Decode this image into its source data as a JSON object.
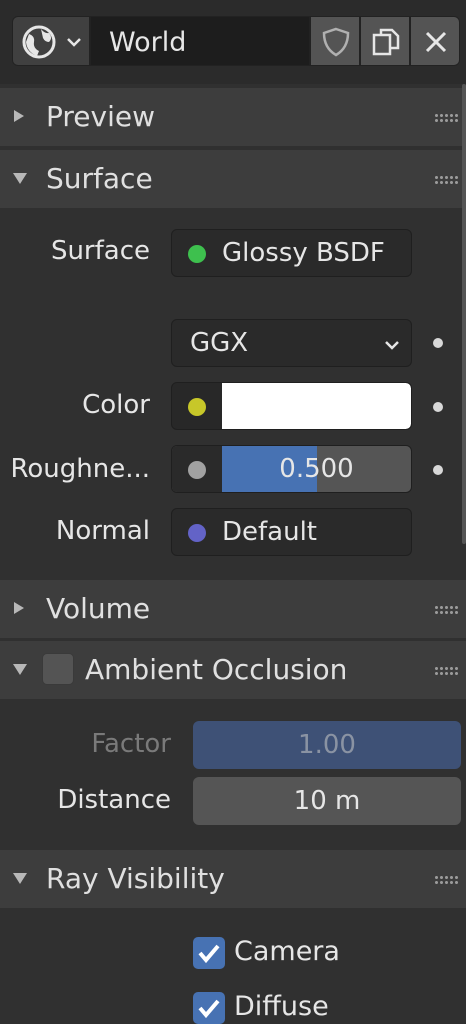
{
  "header": {
    "name": "World",
    "type_icon": "world-icon",
    "fake_user_icon": "shield-icon",
    "duplicate_icon": "duplicate-icon",
    "unlink_icon": "close-icon"
  },
  "panels": {
    "preview": {
      "title": "Preview",
      "expanded": false
    },
    "surface": {
      "title": "Surface",
      "expanded": true
    },
    "volume": {
      "title": "Volume",
      "expanded": false
    },
    "ao": {
      "title": "Ambient Occlusion",
      "expanded": true,
      "enabled": false
    },
    "ray": {
      "title": "Ray Visibility",
      "expanded": true
    }
  },
  "surface": {
    "surface_label": "Surface",
    "surface_value": "Glossy BSDF",
    "distribution": "GGX",
    "color_label": "Color",
    "color_value": "#ffffff",
    "roughness_label": "Roughne...",
    "roughness_value": "0.500",
    "roughness_fraction": 0.5,
    "normal_label": "Normal",
    "normal_value": "Default",
    "socket_colors": {
      "shader": "#3ec04e",
      "color": "#c7c729",
      "float": "#a1a1a1",
      "vector": "#6363c7"
    }
  },
  "ao": {
    "factor_label": "Factor",
    "factor_value": "1.00",
    "distance_label": "Distance",
    "distance_value": "10 m"
  },
  "ray_visibility": {
    "camera_label": "Camera",
    "camera_checked": true,
    "diffuse_label": "Diffuse",
    "diffuse_checked": true
  },
  "colors": {
    "accent": "#4772b3",
    "panel_bg": "#303030",
    "header_bg": "#3d3d3d"
  }
}
